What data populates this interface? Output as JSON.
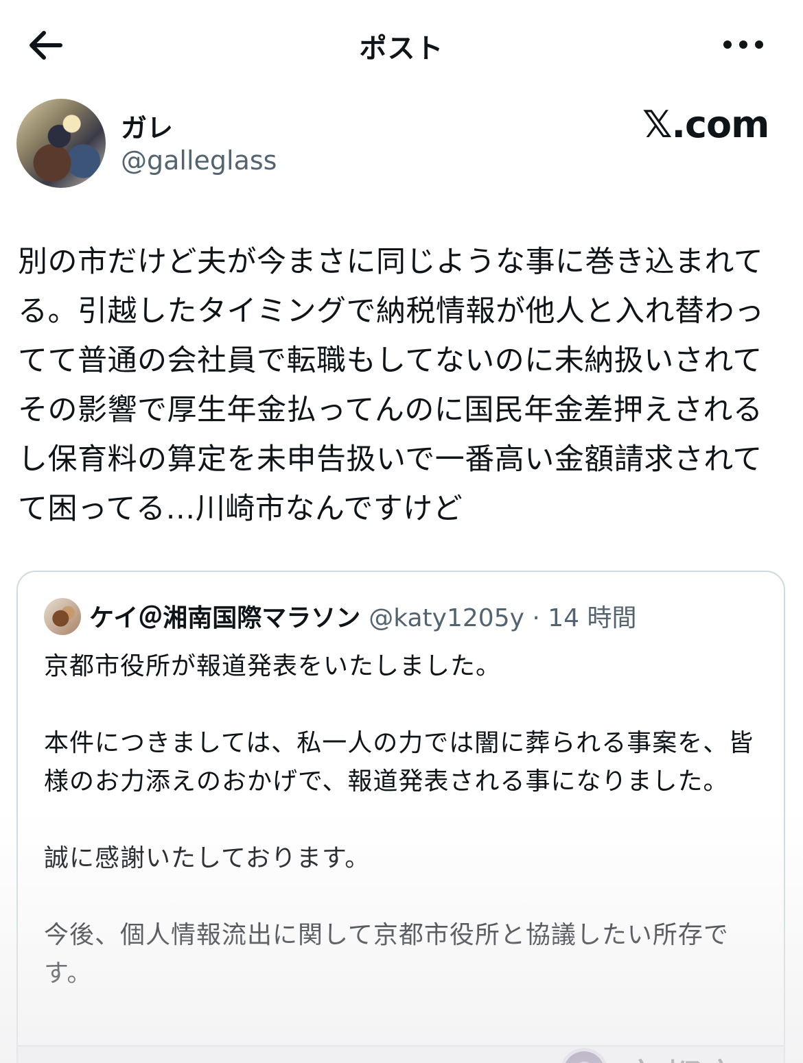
{
  "header": {
    "title": "ポスト",
    "back_icon": "arrow-left-icon",
    "more_icon": "more-horizontal-icon"
  },
  "author": {
    "display_name": "ガレ",
    "handle": "@galleglass"
  },
  "watermark": "𝕏.com",
  "post": {
    "text": "別の市だけど夫が今まさに同じような事に巻き込まれてる。引越したタイミングで納税情報が他人と入れ替わってて普通の会社員で転職もしてないのに未納扱いされてその影響で厚生年金払ってんのに国民年金差押えされるし保育料の算定を未申告扱いで一番高い金額請求されてて困ってる…川崎市なんですけど"
  },
  "quote": {
    "display_name": "ケイ＠湘南国際マラソン",
    "meta": "@katy1205y · 14 時間",
    "text": "京都市役所が報道発表をいたしました。\n\n本件につきましては、私一人の力では闇に葬られる事案を、皆様のお力添えのおかげで、報道発表される事になりました。\n\n誠に感謝いたしております。\n\n今後、個人情報流出に関して京都市役所と協議したい所存です。",
    "image_caption": "京都市"
  },
  "colors": {
    "text_primary": "#0f1419",
    "text_secondary": "#536471",
    "border": "#cfd9de",
    "background": "#ffffff"
  }
}
